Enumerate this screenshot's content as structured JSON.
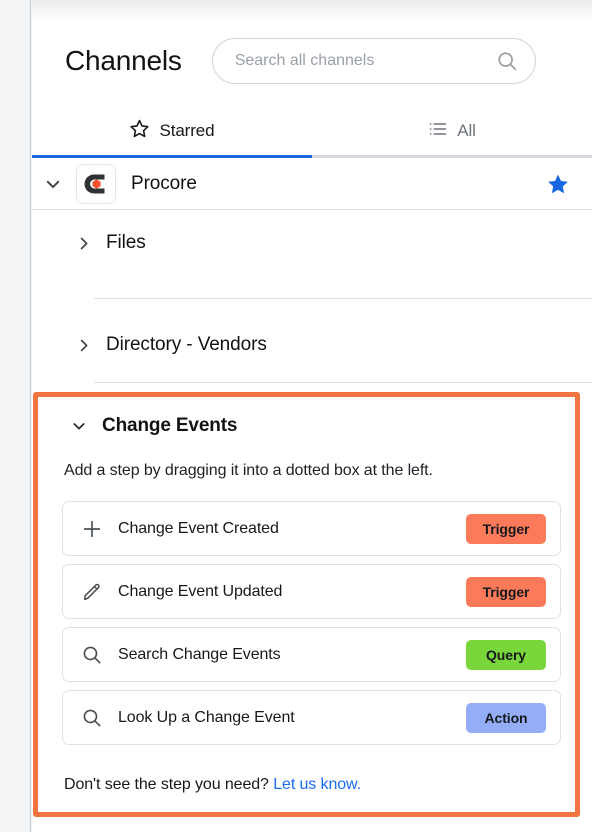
{
  "header": {
    "title": "Channels",
    "search": {
      "placeholder": "Search all channels",
      "value": "",
      "icon": "search-icon"
    }
  },
  "tabs": [
    {
      "label": "Starred",
      "icon": "star-outline-icon",
      "active": true
    },
    {
      "label": "All",
      "icon": "list-icon",
      "active": false
    }
  ],
  "channel": {
    "name": "Procore",
    "expand_icon": "chevron-down-icon",
    "logo_icon": "procore-logo-icon",
    "starred_icon": "star-filled-icon",
    "starred_color": "#1667e0",
    "logo_colors": {
      "mark": "#2f3133",
      "dot": "#f4502a"
    }
  },
  "sections": [
    {
      "title": "Files",
      "icon": "chevron-right-icon",
      "expanded": false
    },
    {
      "title": "Directory - Vendors",
      "icon": "chevron-right-icon",
      "expanded": false
    }
  ],
  "expanded_section": {
    "title": "Change Events",
    "icon": "chevron-down-icon",
    "hint": "Add a step by dragging it into a dotted box at the left.",
    "highlight_color": "#f27441",
    "steps": [
      {
        "label": "Change Event Created",
        "icon": "plus-icon",
        "badge": "Trigger",
        "badge_type": "trigger",
        "badge_color": "#fb7a5a"
      },
      {
        "label": "Change Event Updated",
        "icon": "pencil-icon",
        "badge": "Trigger",
        "badge_type": "trigger",
        "badge_color": "#fb7a5a"
      },
      {
        "label": "Search Change Events",
        "icon": "search-icon",
        "badge": "Query",
        "badge_type": "query",
        "badge_color": "#79d63b"
      },
      {
        "label": "Look Up a Change Event",
        "icon": "search-icon",
        "badge": "Action",
        "badge_type": "action",
        "badge_color": "#93adf7"
      }
    ],
    "footer": {
      "text": "Don't see the step you need?",
      "link_label": "Let us know.",
      "link_color": "#1a6cf0"
    }
  }
}
